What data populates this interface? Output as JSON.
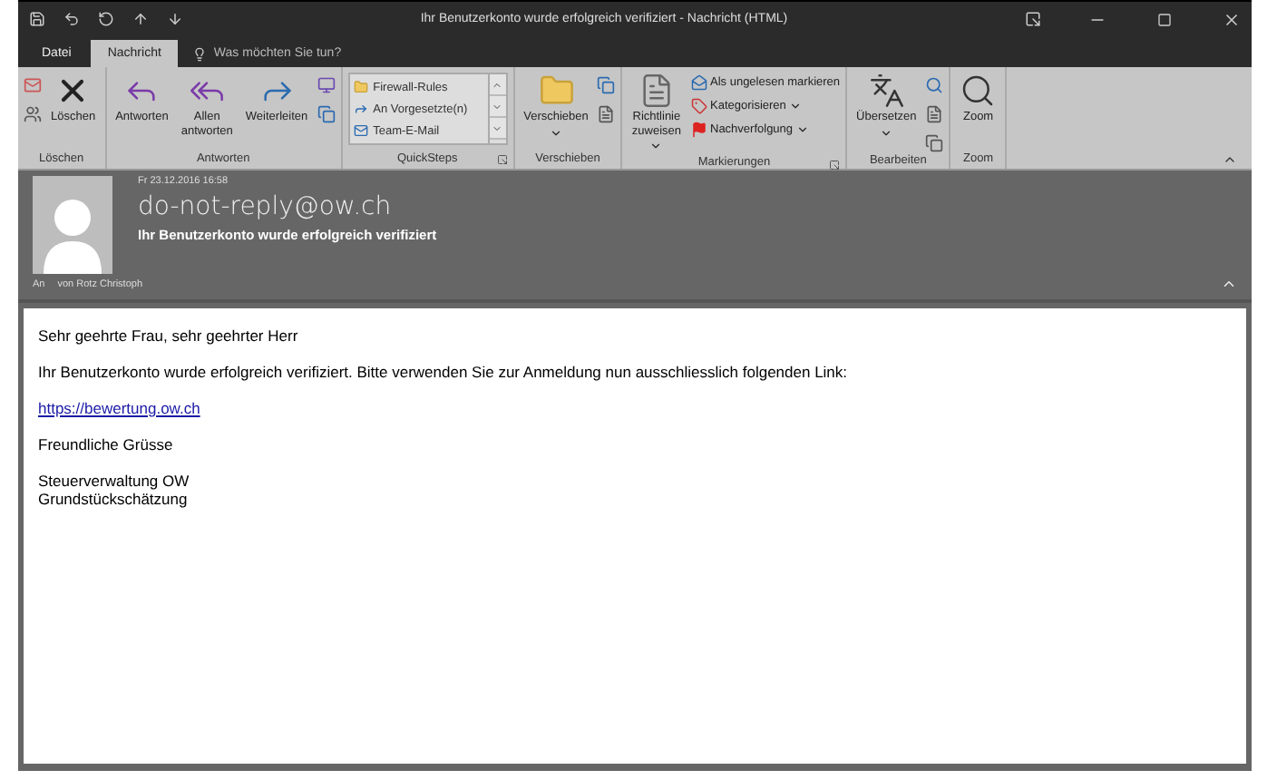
{
  "window": {
    "title": "Ihr Benutzerkonto wurde erfolgreich verifiziert - Nachricht (HTML)"
  },
  "tabs": [
    {
      "label": "Datei",
      "selected": false
    },
    {
      "label": "Nachricht",
      "selected": true
    }
  ],
  "tell_me": {
    "placeholder": "Was möchten Sie tun?"
  },
  "ribbon": {
    "groups": [
      {
        "label": "Löschen",
        "launcher": false,
        "items": [
          {
            "kind": "icon-stack"
          },
          {
            "kind": "large",
            "lines": [
              "Löschen"
            ],
            "dropdown": false
          }
        ]
      },
      {
        "label": "Antworten",
        "launcher": false,
        "items": [
          {
            "kind": "large",
            "lines": [
              "Antworten"
            ],
            "dropdown": false
          },
          {
            "kind": "large",
            "lines": [
              "Allen",
              "antworten"
            ],
            "dropdown": false
          },
          {
            "kind": "large",
            "lines": [
              "Weiterleiten"
            ],
            "dropdown": false
          },
          {
            "kind": "icon-stack"
          }
        ]
      },
      {
        "label": "QuickSteps",
        "launcher": true,
        "items": [
          {
            "kind": "gallery",
            "entries": [
              "Firewall-Rules",
              "An Vorgesetzte(n)",
              "Team-E-Mail"
            ]
          }
        ]
      },
      {
        "label": "Verschieben",
        "launcher": false,
        "items": [
          {
            "kind": "large",
            "lines": [
              "Verschieben"
            ],
            "dropdown": true
          },
          {
            "kind": "icon-stack"
          }
        ]
      },
      {
        "label": "Markierungen",
        "launcher": true,
        "items": [
          {
            "kind": "large",
            "lines": [
              "Richtlinie",
              "zuweisen"
            ],
            "dropdown": true
          },
          {
            "kind": "small-list",
            "entries": [
              {
                "label": "Als ungelesen markieren",
                "dropdown": false
              },
              {
                "label": "Kategorisieren",
                "dropdown": true
              },
              {
                "label": "Nachverfolgung",
                "dropdown": true
              }
            ]
          }
        ]
      },
      {
        "label": "Bearbeiten",
        "launcher": false,
        "items": [
          {
            "kind": "large",
            "lines": [
              "Übersetzen"
            ],
            "dropdown": true
          },
          {
            "kind": "icon-stack"
          }
        ]
      },
      {
        "label": "Zoom",
        "launcher": false,
        "items": [
          {
            "kind": "large",
            "lines": [
              "Zoom"
            ],
            "dropdown": false
          }
        ]
      }
    ]
  },
  "message": {
    "date": "Fr 23.12.2016 16:58",
    "sender": "do-not-reply@ow.ch",
    "subject": "Ihr Benutzerkonto wurde erfolgreich verifiziert",
    "to_label": "An",
    "to": "von Rotz Christoph"
  },
  "body": {
    "paragraphs": [
      {
        "kind": "text",
        "lines": [
          "Sehr geehrte Frau, sehr geehrter Herr"
        ]
      },
      {
        "kind": "text",
        "lines": [
          "Ihr Benutzerkonto wurde erfolgreich verifiziert. Bitte verwenden Sie zur Anmeldung nun ausschliesslich folgenden Link:"
        ]
      },
      {
        "kind": "link",
        "lines": [
          "https://bewertung.ow.ch"
        ]
      },
      {
        "kind": "text",
        "lines": [
          "Freundliche Grüsse"
        ]
      },
      {
        "kind": "text",
        "lines": [
          "Steuerverwaltung OW",
          "Grundstückschätzung"
        ]
      }
    ]
  }
}
